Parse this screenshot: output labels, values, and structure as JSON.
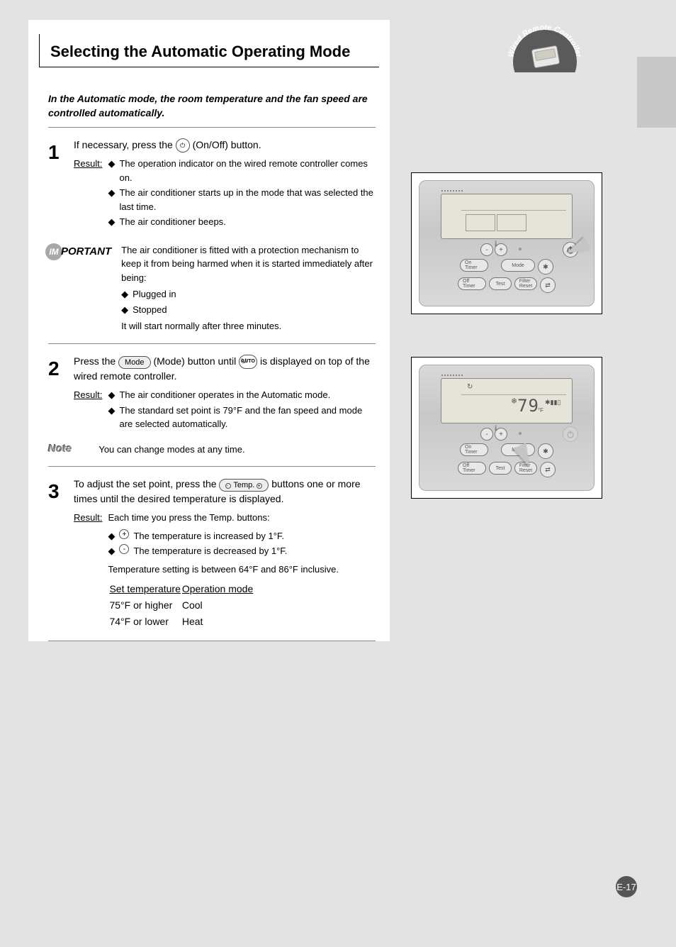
{
  "badge": {
    "arc_text": "Wired Remote Controller"
  },
  "title": "Selecting the Automatic Operating Mode",
  "intro": "In the Automatic mode, the room temperature and the fan speed are controlled automatically.",
  "steps": {
    "s1": {
      "num": "1",
      "line1_a": "If necessary, press the ",
      "line1_b": " (On/Off) button.",
      "result_label": "Result:",
      "bullets": [
        "The operation indicator on the wired remote controller comes on.",
        "The air conditioner starts up in the mode that was selected the last time.",
        "The air conditioner beeps."
      ]
    },
    "important": {
      "label": "IMPORTANT",
      "body_a": "The air conditioner is fitted with a protection mechanism to keep it from being harmed when it is started immediately after being:",
      "bullets": [
        "Plugged in",
        "Stopped"
      ],
      "body_b": "It will start normally after three minutes."
    },
    "s2": {
      "num": "2",
      "line_a": "Press the ",
      "mode_btn": "Mode",
      "line_b": " (Mode) button until ",
      "line_c": " is displayed on top of the wired remote controller.",
      "result_label": "Result:",
      "bullets": [
        "The air conditioner operates in the Automatic mode.",
        "The standard set point is 79°F and the fan speed and mode are selected automatically."
      ]
    },
    "note": {
      "label": "Note",
      "body": "You can change modes at any time."
    },
    "s3": {
      "num": "3",
      "line_a": "To adjust the set point, press the ",
      "temp_btn": "Temp.",
      "line_b": " buttons one or more times until the desired temperature is displayed.",
      "result_label": "Result:",
      "result_body": "Each time you press the Temp. buttons:",
      "rows": [
        {
          "btn": "+",
          "desc": "The temperature is increased by 1°F."
        },
        {
          "btn": "-",
          "desc": "The temperature is decreased by 1°F."
        }
      ],
      "range_note": "Temperature setting is between 64°F and 86°F inclusive.",
      "table": {
        "header": [
          "Set temperature",
          "Operation mode"
        ],
        "row1": [
          "75°F or higher",
          "Cool"
        ],
        "row2": [
          "74°F or lower",
          "Heat"
        ]
      }
    }
  },
  "remote": {
    "lcd_temp": "79",
    "lcd_unit": "°F",
    "btn_on_timer": "On Timer",
    "btn_off_timer": "Off Timer",
    "btn_mode": "Mode",
    "btn_test": "Test",
    "btn_filter": "Filter Reset",
    "fan_icon": "✱▮▮▯",
    "auto_icon": "↻"
  },
  "page_num": "E-17"
}
